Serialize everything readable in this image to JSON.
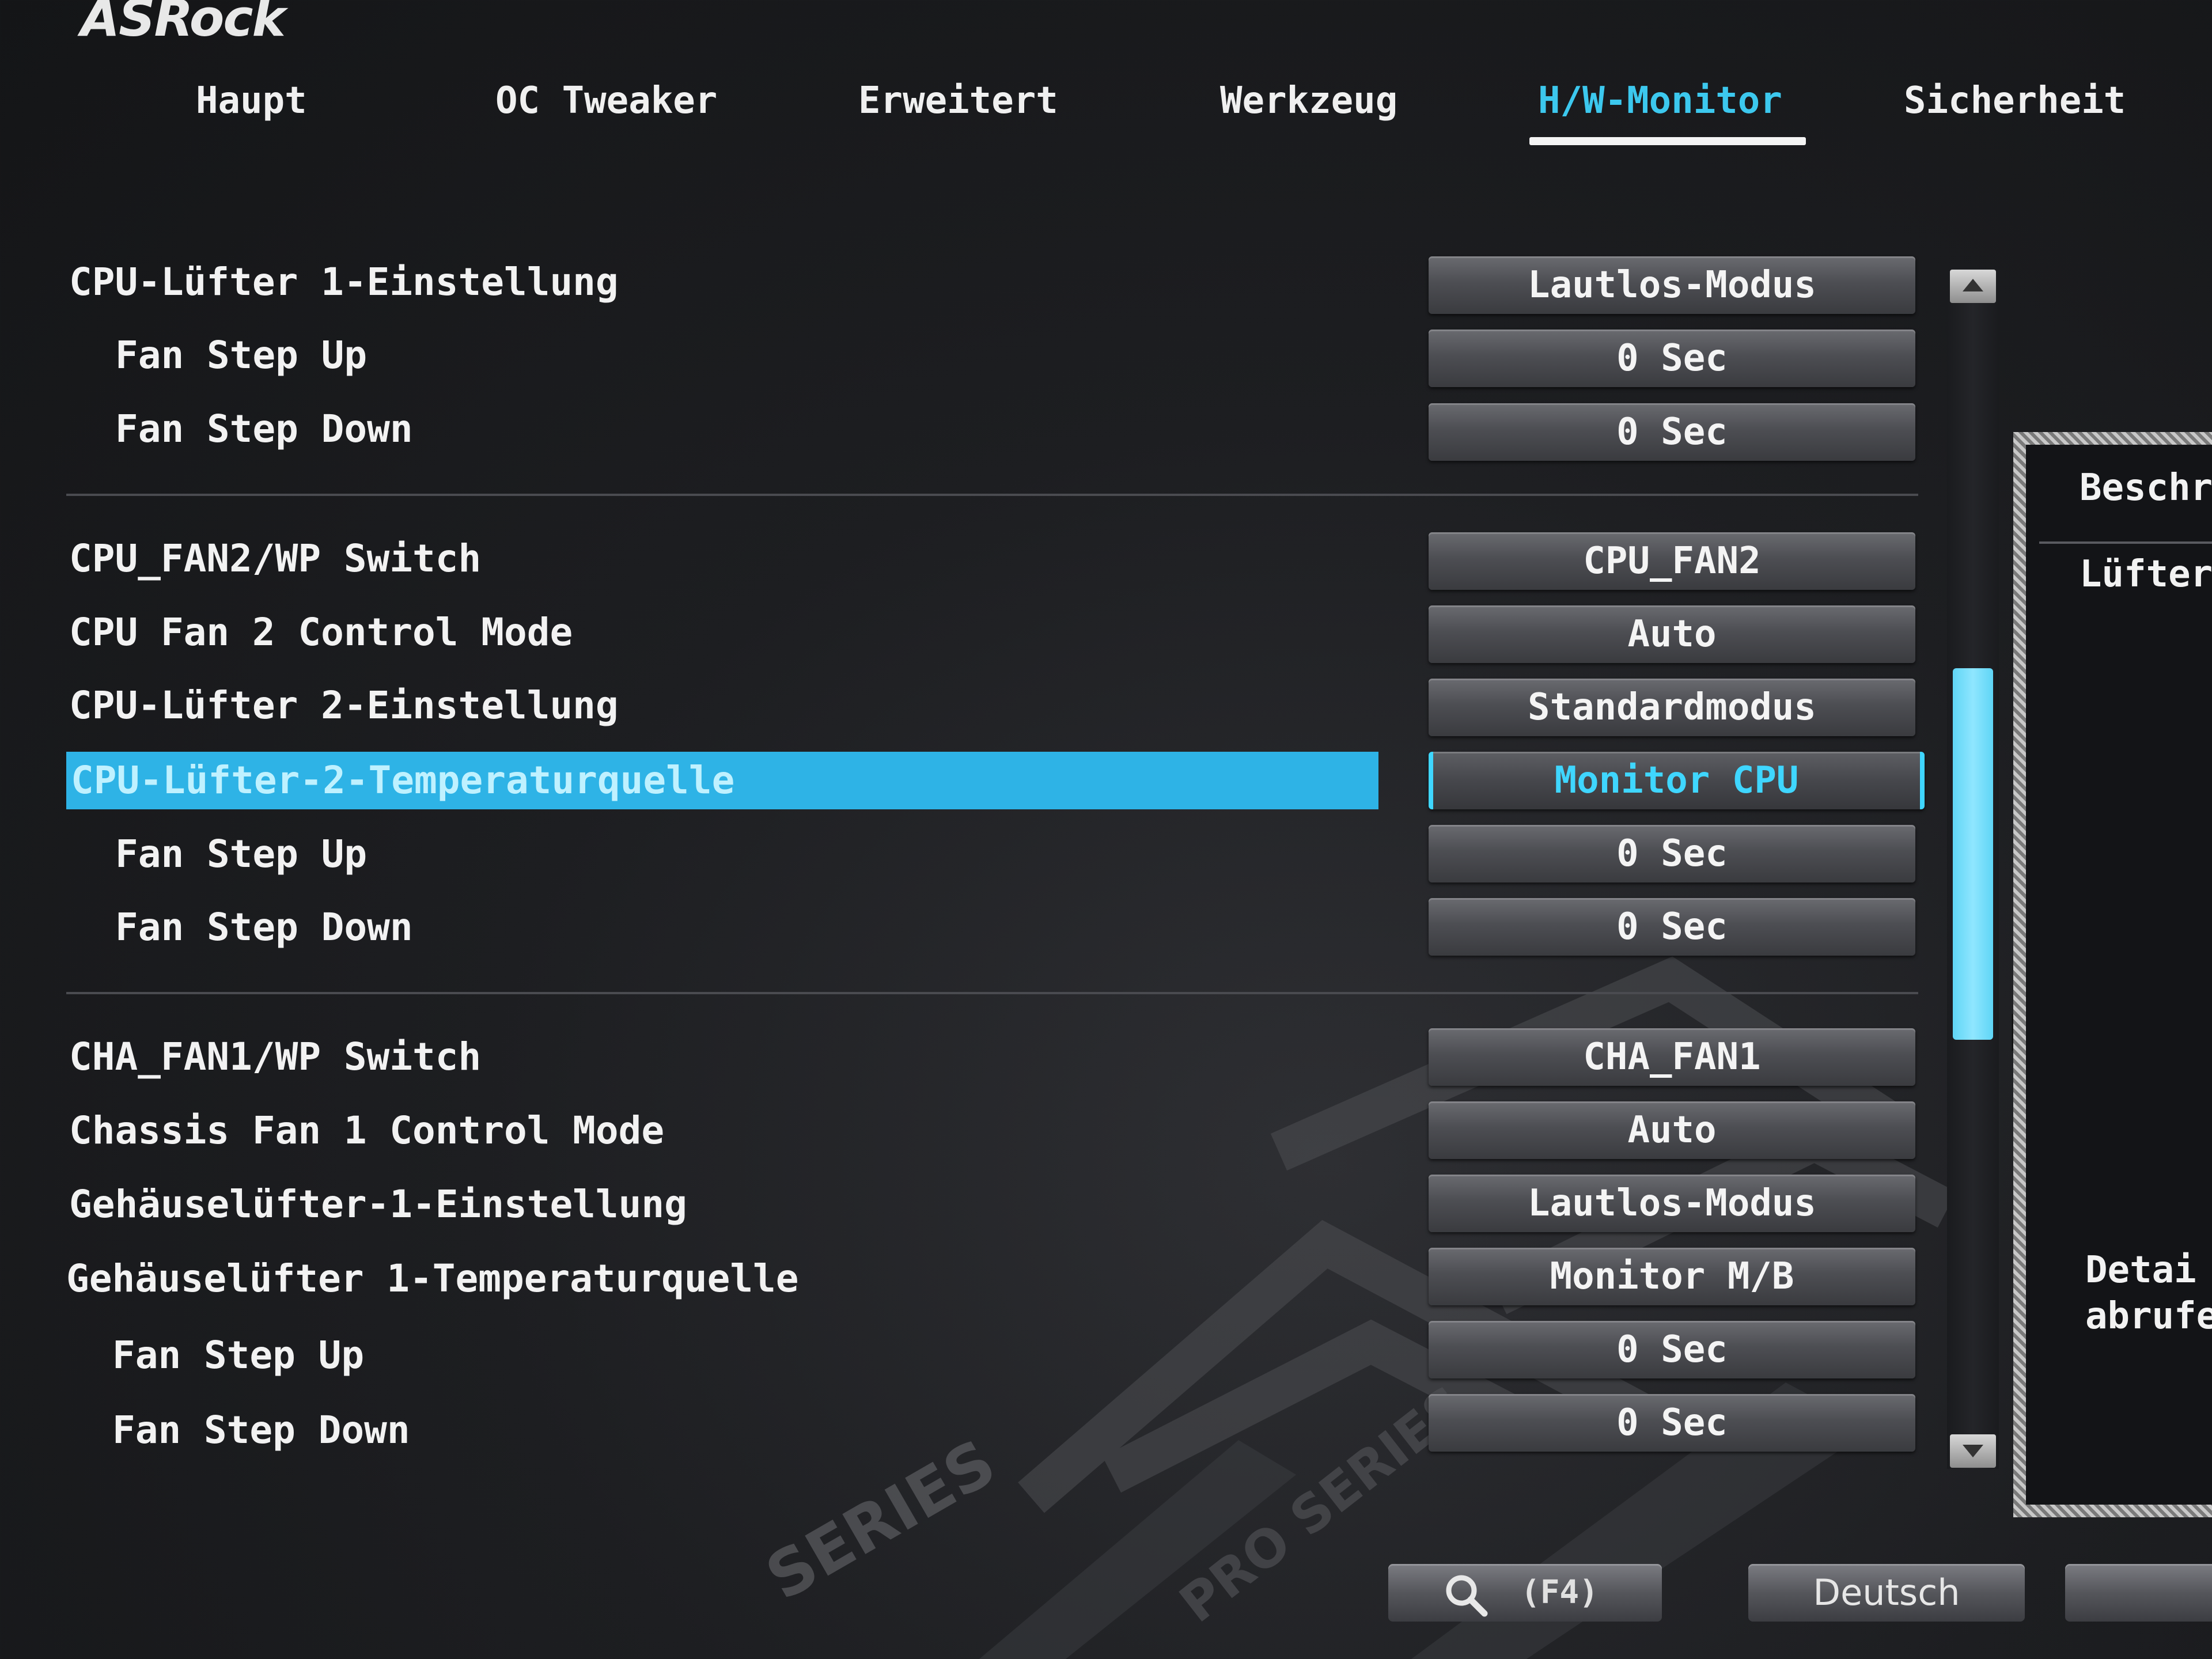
{
  "brand": "ASRock",
  "tabs": [
    {
      "label": "Haupt"
    },
    {
      "label": "OC Tweaker"
    },
    {
      "label": "Erweitert"
    },
    {
      "label": "Werkzeug"
    },
    {
      "label": "H/W-Monitor",
      "active": true
    },
    {
      "label": "Sicherheit"
    }
  ],
  "settings": [
    {
      "label": "CPU-Lüfter 1-Einstellung",
      "value": "Lautlos-Modus"
    },
    {
      "label": "Fan Step Up",
      "value": "0 Sec"
    },
    {
      "label": "Fan Step Down",
      "value": "0 Sec"
    },
    {
      "label": "CPU_FAN2/WP Switch",
      "value": "CPU_FAN2"
    },
    {
      "label": "CPU Fan 2 Control Mode",
      "value": "Auto"
    },
    {
      "label": "CPU-Lüfter 2-Einstellung",
      "value": "Standardmodus"
    },
    {
      "label": "CPU-Lüfter-2-Temperaturquelle",
      "value": "Monitor CPU",
      "selected": true
    },
    {
      "label": "Fan Step Up",
      "value": "0 Sec"
    },
    {
      "label": "Fan Step Down",
      "value": "0 Sec"
    },
    {
      "label": "CHA_FAN1/WP Switch",
      "value": "CHA_FAN1"
    },
    {
      "label": "Chassis Fan 1 Control Mode",
      "value": "Auto"
    },
    {
      "label": "Gehäuselüfter-1-Einstellung",
      "value": "Lautlos-Modus"
    },
    {
      "label": "Gehäuselüfter 1-Temperaturquelle",
      "value": "Monitor M/B"
    },
    {
      "label": "Fan Step Up",
      "value": "0 Sec"
    },
    {
      "label": "Fan Step Down",
      "value": "0 Sec"
    }
  ],
  "description": {
    "title": "Beschr",
    "text": "Lüfter",
    "bottom": "Detai\nabrufe"
  },
  "bottom_bar": {
    "search_key": "(F4)",
    "language": "Deutsch",
    "extra": ""
  },
  "watermark": {
    "series_text": "SERIES",
    "pro_series_text": "PRO SERIES"
  },
  "colors": {
    "accent": "#3cc8ee",
    "selection_bg": "#2eb3e6",
    "scroll_thumb": "#6fdcf8"
  }
}
